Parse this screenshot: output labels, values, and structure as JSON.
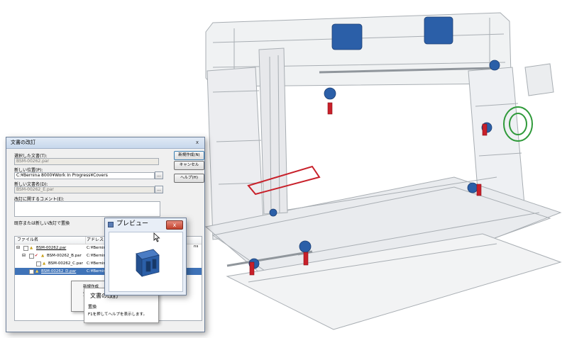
{
  "dialog": {
    "title": "文書の改訂",
    "selected_doc_label": "選択した文書(T):",
    "selected_doc_value": "BSM-00262.par",
    "new_location_label": "新しい位置(P):",
    "new_location_value": "C:¥Bernina 8000¥Work In Progress¥Covers",
    "new_name_label": "新しい文書名(D):",
    "new_name_value": "BSM-00262_E.par",
    "comment_label": "改訂に関するコメント(E):",
    "table_caption": "既存または新しい改訂で置換",
    "buttons": {
      "new_revision": "新規作成(N)",
      "cancel": "キャンセル",
      "help": "ヘルプ(H)"
    },
    "browse_label": "...",
    "close_glyph": "x",
    "table": {
      "columns": [
        "ファイル名",
        "アドレス"
      ],
      "rows": [
        {
          "name": "BSM-00262.par",
          "address": "C:¥Bernina E"
        },
        {
          "name": "BSM-00262_B.par",
          "address": "C:¥Bernina E"
        },
        {
          "name": "BSM-00262_C.par",
          "address": "C:¥Bernina E"
        },
        {
          "name": "BSM-00262_D.par",
          "address": "C:¥Bernina E"
        }
      ],
      "extra_col_fragment": "ns"
    }
  },
  "context_menu": {
    "items": [
      "新規作成",
      "置換"
    ]
  },
  "tooltip": {
    "title": "文書の改訂",
    "heading": "置換",
    "description": "F1を押してヘルプを表示します。"
  },
  "preview": {
    "title": "プレビュー",
    "close_glyph": "x"
  },
  "colors": {
    "part_blue": "#2b5fa8",
    "part_red": "#c8202a",
    "part_green": "#2f9a3a",
    "selection": "#3f73b8"
  }
}
